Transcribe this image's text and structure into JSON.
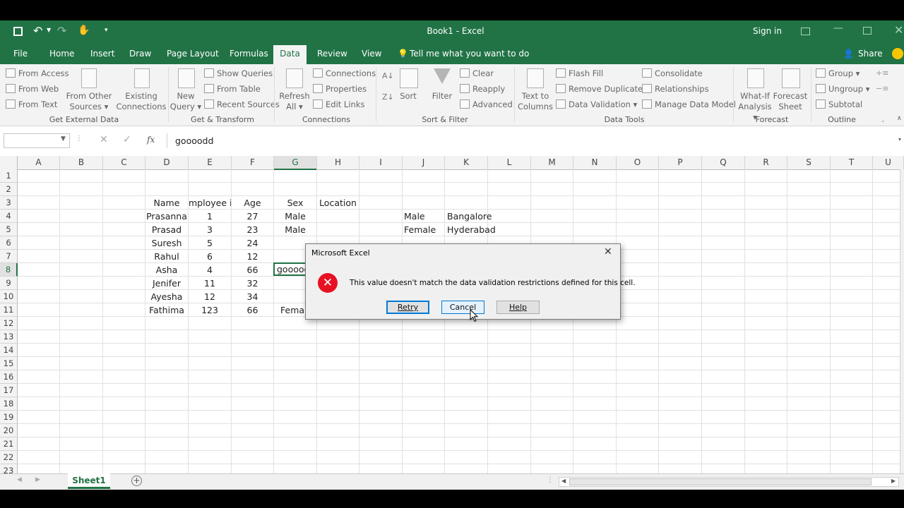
{
  "window": {
    "title": "Book1  -  Excel",
    "sign_in": "Sign in"
  },
  "menu_tabs": [
    "File",
    "Home",
    "Insert",
    "Draw",
    "Page Layout",
    "Formulas",
    "Data",
    "Review",
    "View"
  ],
  "active_tab": "Data",
  "tell_me": "Tell me what you want to do",
  "share": "Share",
  "ribbon": {
    "get_external": {
      "from_access": "From Access",
      "from_web": "From Web",
      "from_text": "From Text",
      "from_other_1": "From Other",
      "from_other_2": "Sources",
      "existing_1": "Existing",
      "existing_2": "Connections",
      "group": "Get External Data"
    },
    "get_transform": {
      "new_query_1": "New",
      "new_query_2": "Query",
      "show_queries": "Show Queries",
      "from_table": "From Table",
      "recent_sources": "Recent Sources",
      "group": "Get & Transform"
    },
    "connections": {
      "refresh_1": "Refresh",
      "refresh_2": "All",
      "connections": "Connections",
      "properties": "Properties",
      "edit_links": "Edit Links",
      "group": "Connections"
    },
    "sort_filter": {
      "sort": "Sort",
      "filter": "Filter",
      "clear": "Clear",
      "reapply": "Reapply",
      "advanced": "Advanced",
      "group": "Sort & Filter"
    },
    "data_tools": {
      "text_to_1": "Text to",
      "text_to_2": "Columns",
      "flash_fill": "Flash Fill",
      "remove_duplicates": "Remove Duplicates",
      "data_validation": "Data Validation",
      "consolidate": "Consolidate",
      "relationships": "Relationships",
      "manage_model": "Manage Data Model",
      "group": "Data Tools"
    },
    "forecast": {
      "whatif_1": "What-If",
      "whatif_2": "Analysis",
      "forecast_1": "Forecast",
      "forecast_2": "Sheet",
      "group": "Forecast"
    },
    "outline": {
      "group_btn": "Group",
      "ungroup": "Ungroup",
      "subtotal": "Subtotal",
      "group": "Outline"
    }
  },
  "formula_bar": {
    "name_box": "",
    "fx": "fx",
    "value": "goooodd"
  },
  "columns": [
    "A",
    "B",
    "C",
    "D",
    "E",
    "F",
    "G",
    "H",
    "I",
    "J",
    "K",
    "L",
    "M",
    "N",
    "O",
    "P",
    "Q",
    "R",
    "S",
    "T",
    "U"
  ],
  "rows": [
    "1",
    "2",
    "3",
    "4",
    "5",
    "6",
    "7",
    "8",
    "9",
    "10",
    "11",
    "12",
    "13",
    "14",
    "15",
    "16",
    "17",
    "18",
    "19",
    "20",
    "21",
    "22",
    "23"
  ],
  "cells": {
    "d3": "Name",
    "e3": "mployee i",
    "f3": "Age",
    "g3": "Sex",
    "h3": "Location",
    "d4": "Prasanna",
    "e4": "1",
    "f4": "27",
    "g4": "Male",
    "j4": "Male",
    "k4": "Bangalore",
    "d5": "Prasad",
    "e5": "3",
    "f5": "23",
    "g5": "Male",
    "j5": "Female",
    "k5": "Hyderabad",
    "d6": "Suresh",
    "e6": "5",
    "f6": "24",
    "d7": "Rahul",
    "e7": "6",
    "f7": "12",
    "d8": "Asha",
    "e8": "4",
    "f8": "66",
    "g8": "gooooddd",
    "d9": "Jenifer",
    "e9": "11",
    "f9": "32",
    "d10": "Ayesha",
    "e10": "12",
    "f10": "34",
    "d11": "Fathima",
    "e11": "123",
    "f11": "66",
    "g11": "Female"
  },
  "sheet_tab": "Sheet1",
  "dialog": {
    "title": "Microsoft Excel",
    "message": "This value doesn't match the data validation restrictions defined for this cell.",
    "retry": "Retry",
    "cancel": "Cancel",
    "help": "Help"
  },
  "colors": {
    "excel_green": "#217346",
    "error_red": "#e81123",
    "focus_blue": "#0078d7"
  }
}
